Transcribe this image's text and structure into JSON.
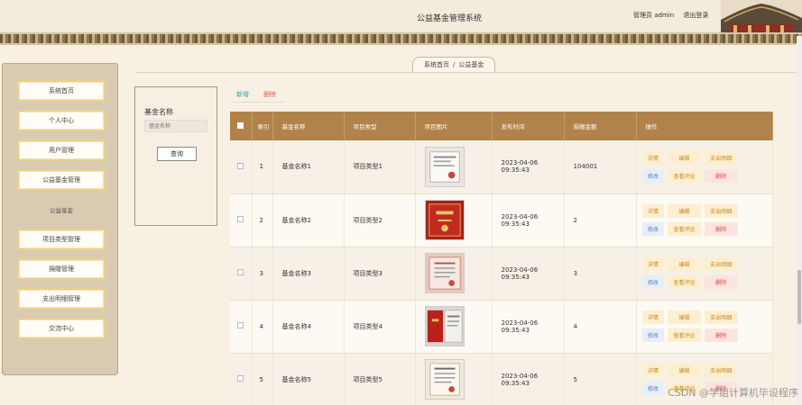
{
  "header": {
    "title": "公益基金管理系统",
    "admin_label": "管理员 admin",
    "logout": "退出登录"
  },
  "breadcrumb": {
    "home": "系统首页",
    "separator": "/",
    "current": "公益基金"
  },
  "sidebar": {
    "items": [
      {
        "label": "系统首页"
      },
      {
        "label": "个人中心"
      },
      {
        "label": "用户管理"
      },
      {
        "label": "公益基金管理"
      },
      {
        "label": "项目类型管理"
      },
      {
        "label": "捐赠管理"
      },
      {
        "label": "支出明细管理"
      },
      {
        "label": "交流中心"
      }
    ],
    "sub_label": "公益基金"
  },
  "search": {
    "label": "基金名称",
    "placeholder": "基金名称",
    "button": "查询"
  },
  "actions": {
    "add": "新增",
    "delete": "删除"
  },
  "table": {
    "headers": [
      "索引",
      "基金名称",
      "项目类型",
      "项目图片",
      "发布时间",
      "捐赠金额",
      "操作"
    ],
    "rows": [
      {
        "idx": "1",
        "name": "基金名称1",
        "type": "项目类型1",
        "time": "2023-04-06 09:35:43",
        "amount": "104001"
      },
      {
        "idx": "2",
        "name": "基金名称2",
        "type": "项目类型2",
        "time": "2023-04-06 09:35:43",
        "amount": "2"
      },
      {
        "idx": "3",
        "name": "基金名称3",
        "type": "项目类型3",
        "time": "2023-04-06 09:35:43",
        "amount": "3"
      },
      {
        "idx": "4",
        "name": "基金名称4",
        "type": "项目类型4",
        "time": "2023-04-06 09:35:43",
        "amount": "4"
      },
      {
        "idx": "5",
        "name": "基金名称5",
        "type": "项目类型5",
        "time": "2023-04-06 09:35:43",
        "amount": "5"
      }
    ],
    "ops": {
      "detail": "详情",
      "edit": "编辑",
      "expense": "支出明细",
      "modify": "修改",
      "comment": "查看评论",
      "remove": "删除"
    }
  },
  "watermark": "CSDN @学姐计算机毕设程序"
}
